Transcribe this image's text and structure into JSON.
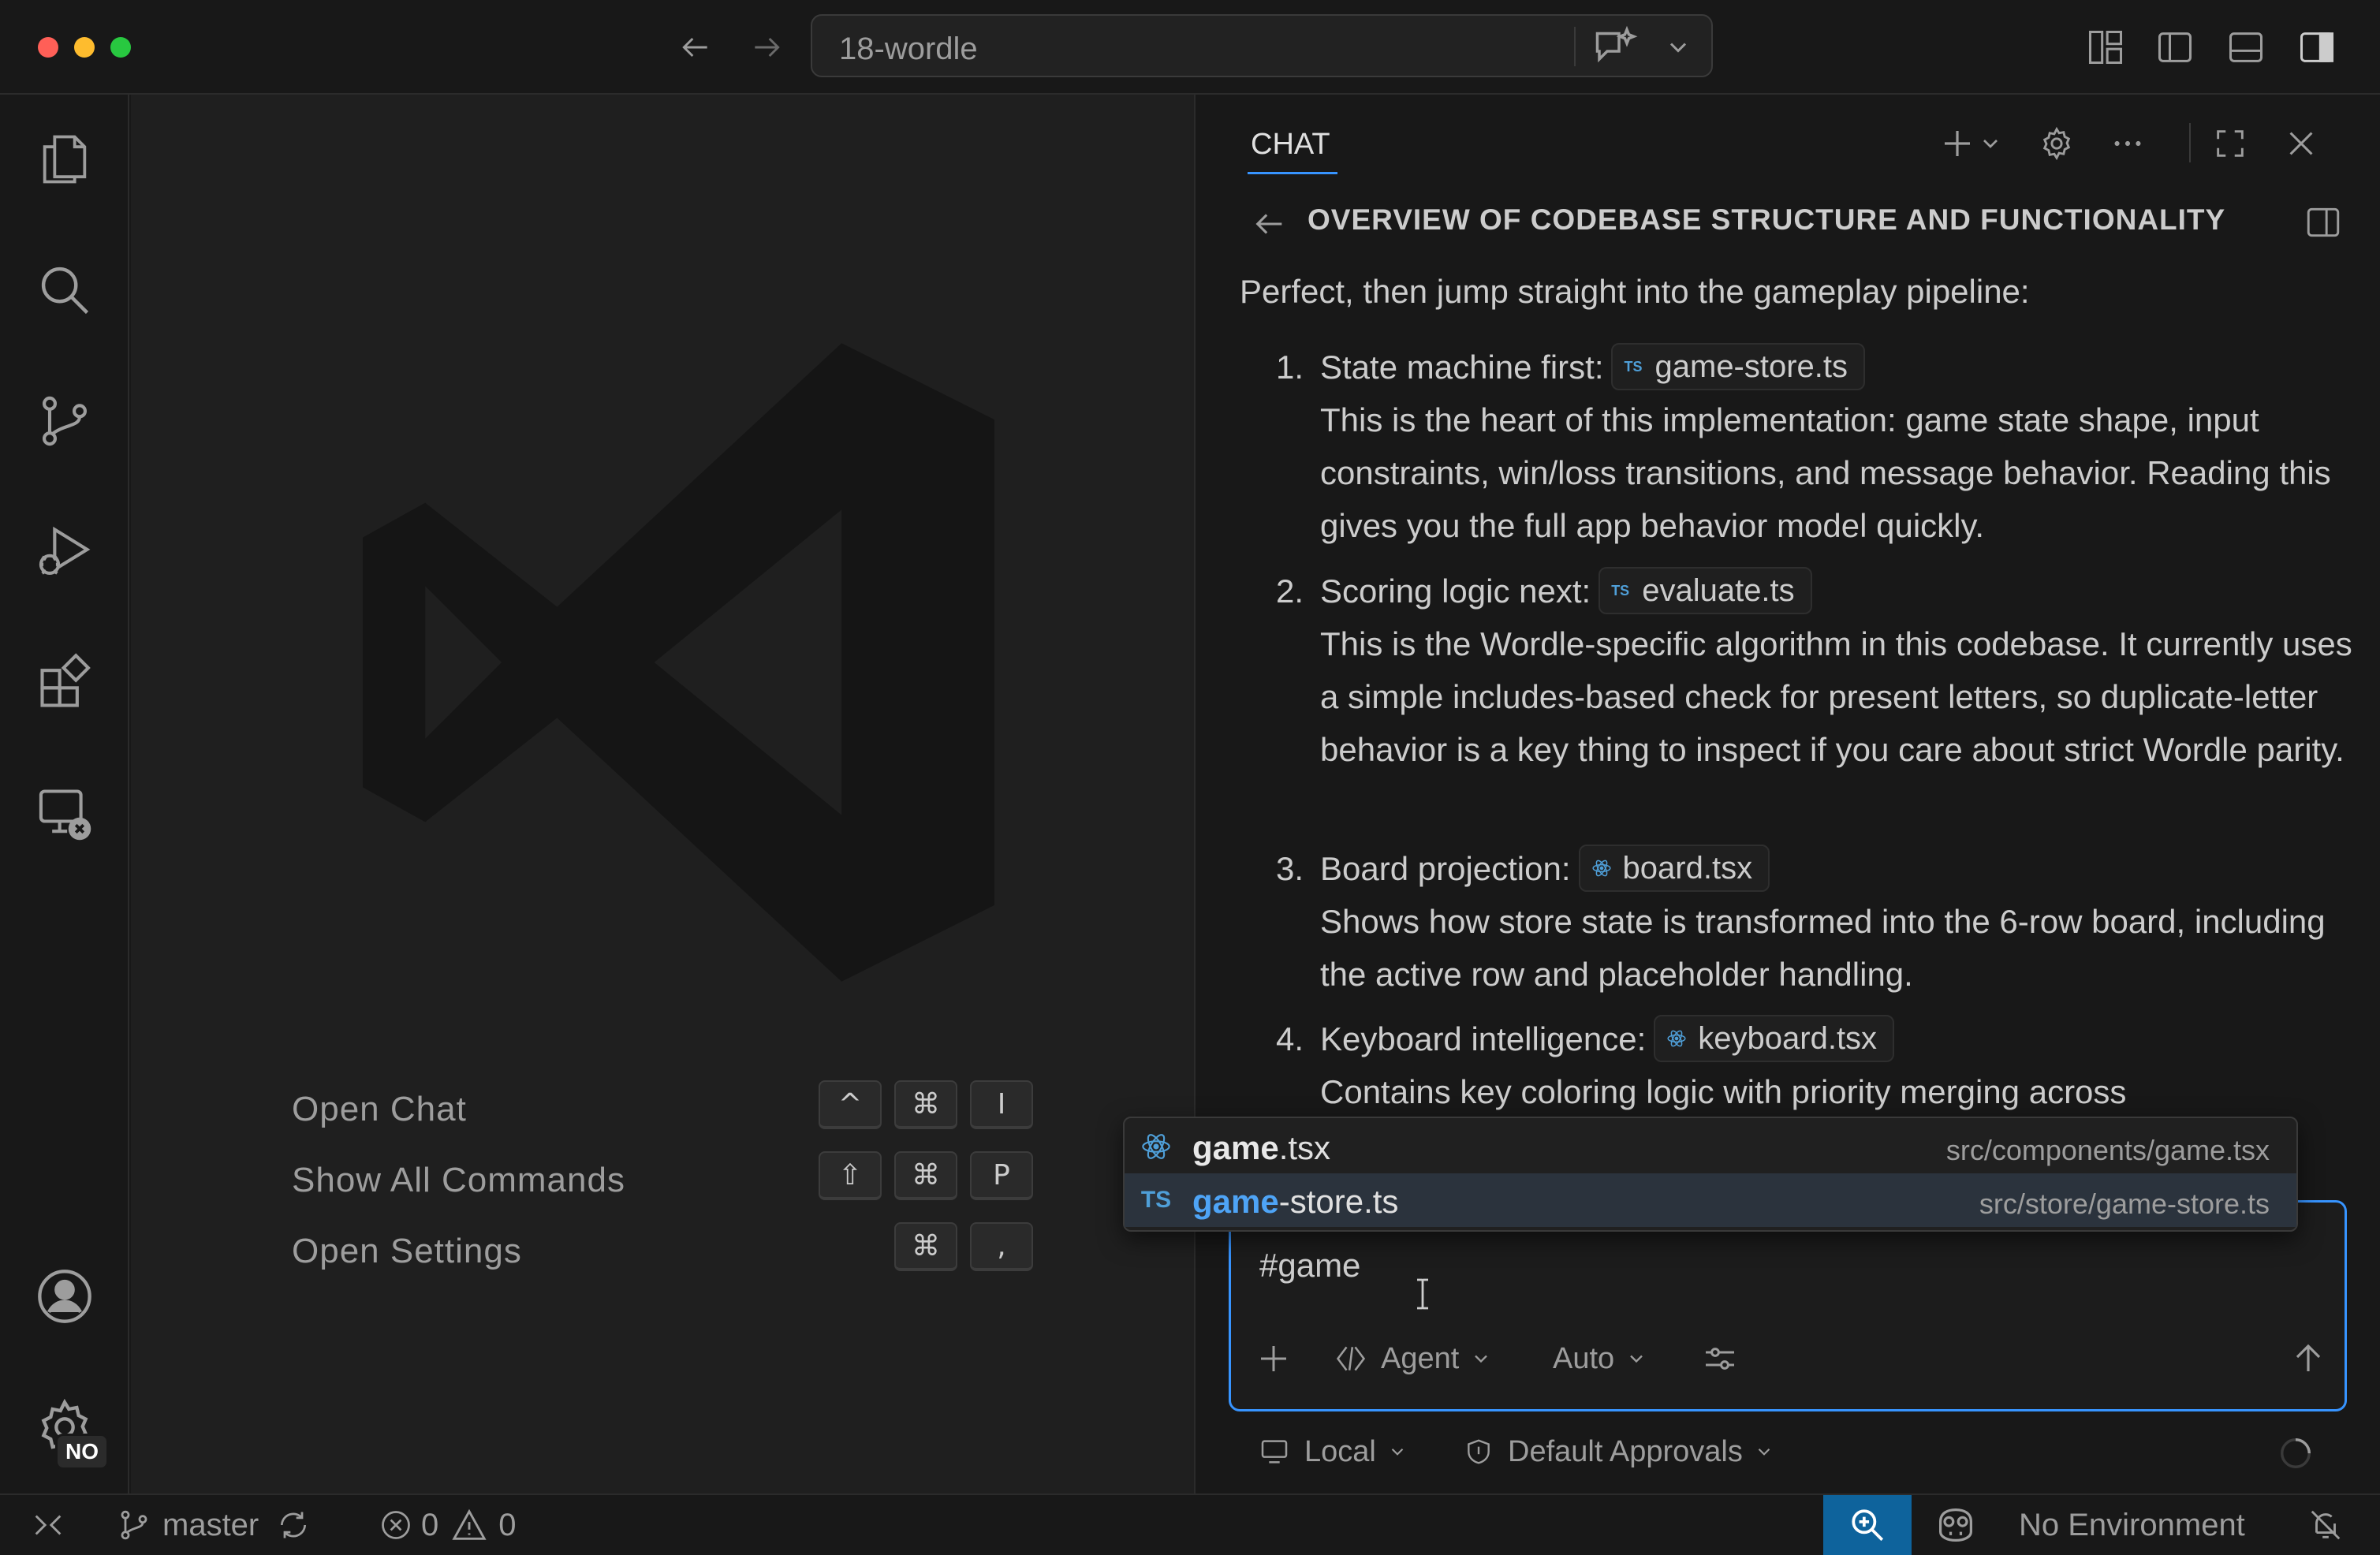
{
  "window": {
    "title": "18-wordle"
  },
  "editor": {
    "shortcuts": [
      {
        "label": "Open Chat",
        "keys": [
          "^",
          "⌘",
          "I"
        ]
      },
      {
        "label": "Show All Commands",
        "keys": [
          "⇧",
          "⌘",
          "P"
        ]
      },
      {
        "label": "Open Settings",
        "keys": [
          "⌘",
          ","
        ]
      }
    ]
  },
  "activity_bar": {
    "items": [
      "explorer-icon",
      "search-icon",
      "source-control-icon",
      "run-debug-icon",
      "extensions-icon",
      "remote-explorer-icon"
    ],
    "bottom": [
      "account-icon",
      "settings-gear-icon"
    ],
    "settings_badge": "NO"
  },
  "chat": {
    "tab_label": "CHAT",
    "thread_title": "OVERVIEW OF CODEBASE STRUCTURE AND FUNCTIONALITY",
    "message": {
      "intro": "Perfect, then jump straight into the gameplay pipeline:",
      "steps": [
        {
          "num": "1.",
          "title": "State machine first:",
          "file": "game-store.ts",
          "file_kind": "TS",
          "body": "This is the heart of this implementation: game state shape, input constraints, win/loss transitions, and message behavior. Reading this gives you the full app behavior model quickly."
        },
        {
          "num": "2.",
          "title": "Scoring logic next:",
          "file": "evaluate.ts",
          "file_kind": "TS",
          "body": "This is the Wordle-specific algorithm in this codebase. It currently uses a simple includes-based check for present letters, so duplicate-letter behavior is a key thing to inspect if you care about strict Wordle parity."
        },
        {
          "num": "3.",
          "title": "Board projection:",
          "file": "board.tsx",
          "file_kind": "react",
          "body": "Shows how store state is transformed into the 6-row board, including the active row and placeholder handling."
        },
        {
          "num": "4.",
          "title": "Keyboard intelligence:",
          "file": "keyboard.tsx",
          "file_kind": "react",
          "body": "Contains key coloring logic with priority merging across"
        }
      ]
    },
    "suggestions": [
      {
        "match": "game",
        "rest": ".tsx",
        "path": "src/components/game.tsx",
        "kind": "react",
        "selected": false
      },
      {
        "match": "game",
        "rest": "-store.ts",
        "path": "src/store/game-store.ts",
        "kind": "TS",
        "selected": true
      }
    ],
    "input": {
      "value": "#game",
      "mode_label": "Agent",
      "model_label": "Auto"
    },
    "footer": {
      "location_label": "Local",
      "approvals_label": "Default Approvals"
    }
  },
  "statusbar": {
    "branch": "master",
    "errors": "0",
    "warnings": "0",
    "environment": "No Environment"
  },
  "colors": {
    "accent": "#3794ff",
    "status_zoom_bg": "#0e639c",
    "ts_badge": "#4f9fd8"
  }
}
